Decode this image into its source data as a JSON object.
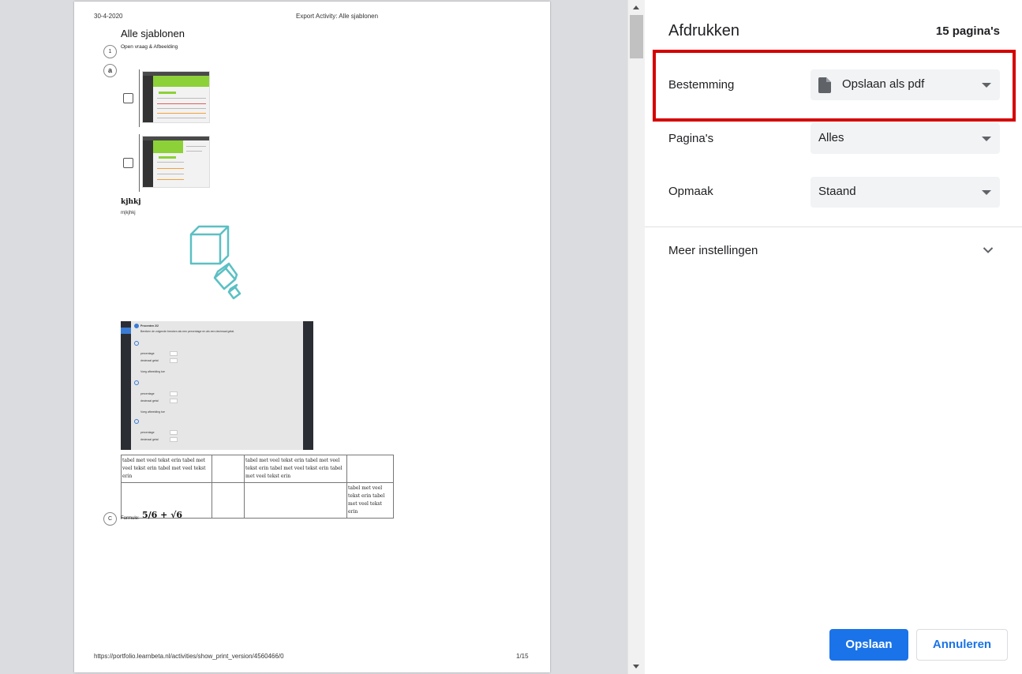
{
  "preview": {
    "header_date": "30-4-2020",
    "header_title": "Export Activity: Alle sjablonen",
    "heading": "Alle sjablonen",
    "question1_number": "1",
    "question1_text": "Open vraag & Afbeelding",
    "question2_number": "a",
    "section_title": "kjhkj",
    "section_sub": "m|kjhkj",
    "table": [
      [
        "tabel met veel tekst erin tabel met veel tekst erin tabel met veel tekst erin",
        "",
        "tabel met veel tekst erin tabel met veel tekst erin tabel met veel tekst erin tabel met veel tekst erin",
        ""
      ],
      [
        "",
        "",
        "",
        "tabel met veel tekst erin tabel met veel tekst erin"
      ]
    ],
    "formula_number": "C",
    "formula_label": "Formule:",
    "formula_expr": "5/6 + √6",
    "footer_url": "https://portfolio.learnbeta.nl/activities/show_print_version/4560466/0",
    "footer_page": "1/15",
    "shot": {
      "title": "Procenten 2/2",
      "instruction": "Bereken de volgende breuken als een percentage en als een decimaal getal.",
      "field1": "percentage",
      "field2": "decimaal getal",
      "hint": "Voeg afbeelding toe"
    }
  },
  "panel": {
    "title": "Afdrukken",
    "page_count": "15 pagina's",
    "destination": {
      "label": "Bestemming",
      "value": "Opslaan als pdf",
      "icon": "file-icon"
    },
    "pages": {
      "label": "Pagina's",
      "value": "Alles"
    },
    "layout": {
      "label": "Opmaak",
      "value": "Staand"
    },
    "more_settings": "Meer instellingen",
    "save": "Opslaan",
    "cancel": "Annuleren"
  },
  "colors": {
    "accent": "#1a73e8",
    "highlight": "#d40000",
    "cube": "#5bc0c4",
    "thumb_green": "#8cd137"
  }
}
